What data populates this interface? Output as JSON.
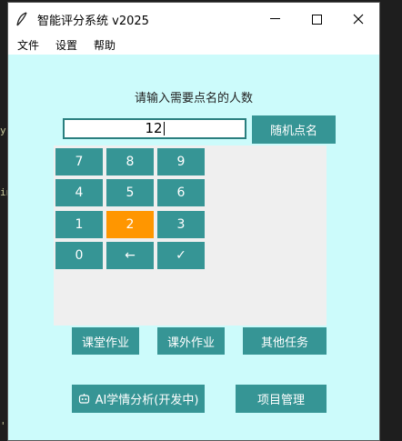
{
  "window": {
    "title": "智能评分系统 v2025"
  },
  "menu": [
    "文件",
    "设置",
    "帮助"
  ],
  "prompt": "请输入需要点名的人数",
  "input": {
    "value": "12"
  },
  "random_button": "随机点名",
  "keypad": {
    "keys": [
      "7",
      "8",
      "9",
      "4",
      "5",
      "6",
      "1",
      "2",
      "3",
      "0",
      "←",
      "✓"
    ],
    "active_key": "2"
  },
  "tasks": [
    "课堂作业",
    "课外作业",
    "其他任务"
  ],
  "ai_button": "AI学情分析(开发中)",
  "project_button": "项目管理",
  "bg_editor": {
    "line1": "y",
    "line2": "in",
    "line3": "'"
  },
  "colors": {
    "window_bg": "#ccfbfb",
    "button": "#369595",
    "active_key": "#ff9600",
    "keypad_bg": "#efefef"
  }
}
